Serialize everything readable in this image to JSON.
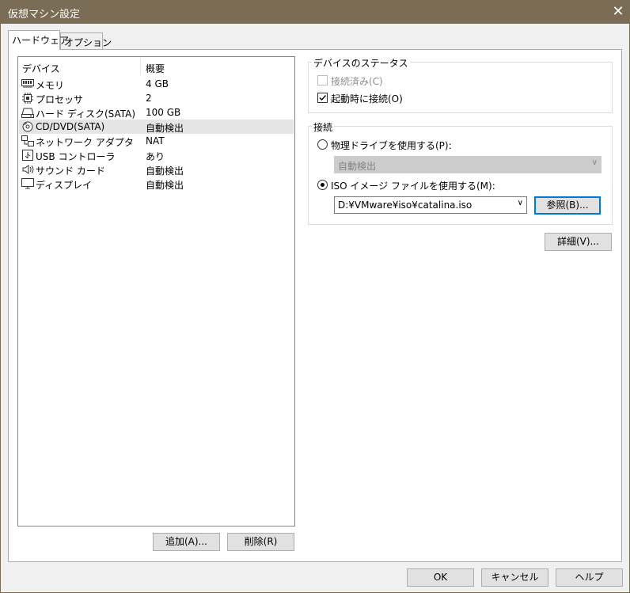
{
  "window": {
    "title": "仮想マシン設定",
    "close_glyph": "✕"
  },
  "tabs": [
    {
      "label": "ハードウェア",
      "active": true
    },
    {
      "label": "オプション",
      "active": false
    }
  ],
  "device_list": {
    "col_device": "デバイス",
    "col_summary": "概要",
    "rows": [
      {
        "icon": "memory-icon",
        "name": "メモリ",
        "value": "4 GB"
      },
      {
        "icon": "processor-icon",
        "name": "プロセッサ",
        "value": "2"
      },
      {
        "icon": "hard-disk-icon",
        "name": "ハード ディスク(SATA)",
        "value": "100 GB"
      },
      {
        "icon": "cd-dvd-icon",
        "name": "CD/DVD(SATA)",
        "value": "自動検出",
        "selected": true
      },
      {
        "icon": "network-adapter-icon",
        "name": "ネットワーク アダプタ",
        "value": "NAT"
      },
      {
        "icon": "usb-controller-icon",
        "name": "USB コントローラ",
        "value": "あり"
      },
      {
        "icon": "sound-card-icon",
        "name": "サウンド カード",
        "value": "自動検出"
      },
      {
        "icon": "display-icon",
        "name": "ディスプレイ",
        "value": "自動検出"
      }
    ]
  },
  "list_buttons": {
    "add": "追加(A)...",
    "remove": "削除(R)"
  },
  "device_status": {
    "group_label": "デバイスのステータス",
    "connected_label": "接続済み(C)",
    "connected_checked": false,
    "connected_disabled": true,
    "connect_at_power_on_label": "起動時に接続(O)",
    "connect_at_power_on_checked": true
  },
  "connection": {
    "group_label": "接続",
    "physical_drive_label": "物理ドライブを使用する(P):",
    "physical_drive_selected": false,
    "physical_drive_value": "自動検出",
    "iso_label": "ISO イメージ ファイルを使用する(M):",
    "iso_selected": true,
    "iso_path": "D:¥VMware¥iso¥catalina.iso",
    "browse_label": "参照(B)..."
  },
  "advanced_button": "詳細(V)...",
  "footer": {
    "ok": "OK",
    "cancel": "キャンセル",
    "help": "ヘルプ"
  }
}
